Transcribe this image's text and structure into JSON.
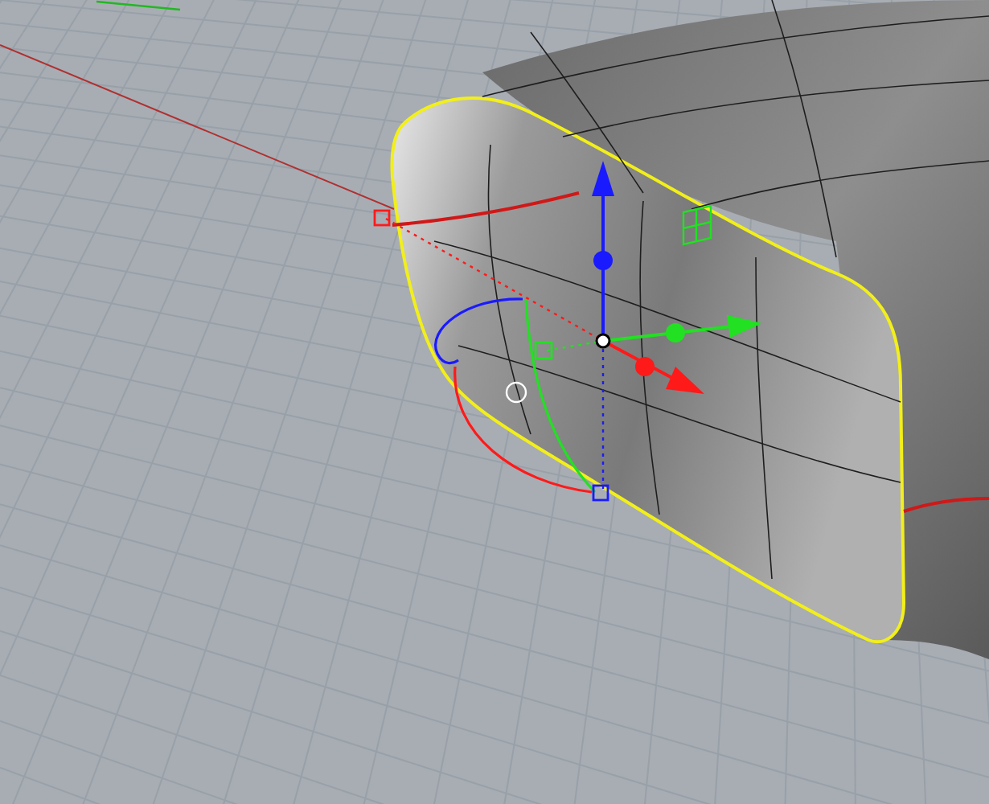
{
  "viewport": {
    "grid": true,
    "world_axes": true,
    "surface": {
      "selected": true
    },
    "gumball": true
  }
}
